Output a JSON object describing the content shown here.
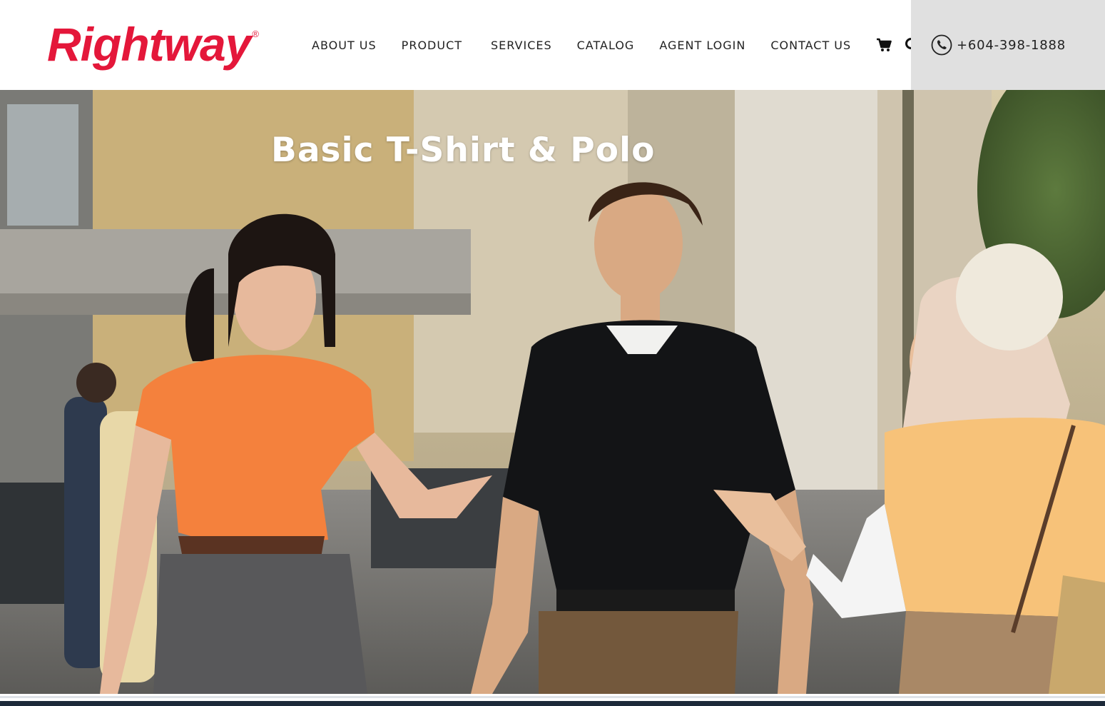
{
  "brand": {
    "name": "Rightway",
    "registered_mark": "®",
    "color": "#e4173a"
  },
  "nav": {
    "items": [
      {
        "label": "ABOUT US"
      },
      {
        "label": "PRODUCT"
      },
      {
        "label": "SERVICES"
      },
      {
        "label": "CATALOG"
      },
      {
        "label": "AGENT LOGIN"
      },
      {
        "label": "CONTACT US"
      }
    ],
    "icons": [
      "cart-icon",
      "search-icon"
    ]
  },
  "contact": {
    "phone": "+604-398-1888",
    "icon": "phone-icon"
  },
  "hero": {
    "title": "Basic T-Shirt & Polo",
    "image_description_hidden": false
  },
  "colors": {
    "header_bg": "#ffffff",
    "phone_box_bg": "#e0e0e0",
    "text": "#222222"
  }
}
